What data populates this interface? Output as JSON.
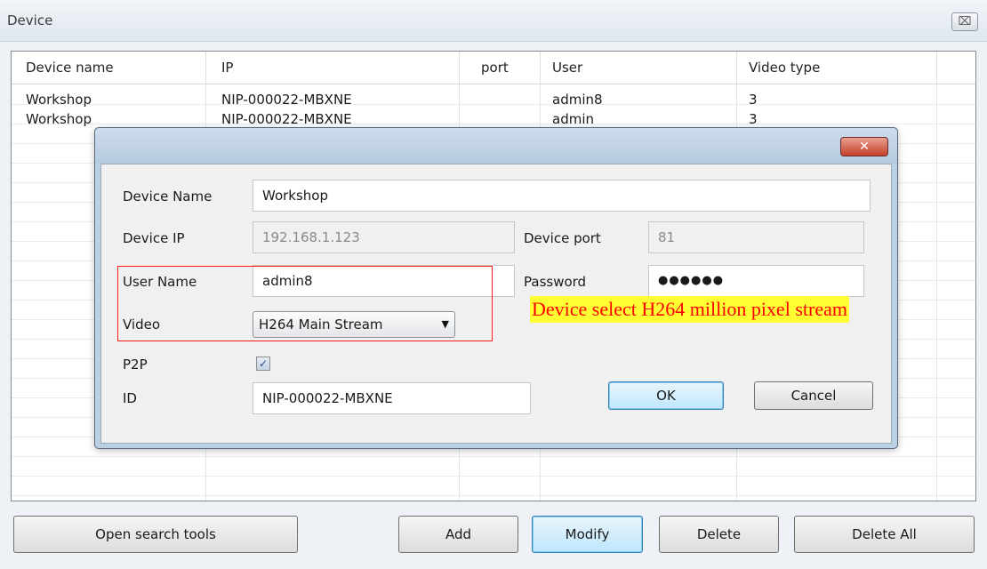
{
  "window": {
    "title": "Device",
    "close_glyph": "⌧"
  },
  "device_list": {
    "columns": [
      "Device name",
      "IP",
      "port",
      "User",
      "Video type"
    ],
    "rows": [
      {
        "name": "Workshop",
        "ip": "NIP-000022-MBXNE",
        "port": "",
        "user": "admin8",
        "video_type": "3"
      },
      {
        "name": "Workshop",
        "ip": "NIP-000022-MBXNE",
        "port": "",
        "user": "admin",
        "video_type": "3"
      }
    ]
  },
  "dialog": {
    "close_glyph": "✕",
    "device_name_label": "Device Name",
    "device_name_value": "Workshop",
    "device_ip_label": "Device IP",
    "device_ip_value": "192.168.1.123",
    "device_port_label": "Device port",
    "device_port_value": "81",
    "user_name_label": "User Name",
    "user_name_value": "admin8",
    "password_label": "Password",
    "password_value": "●●●●●●",
    "video_label": "Video",
    "video_value": "H264 Main Stream",
    "p2p_label": "P2P",
    "p2p_checked": true,
    "p2p_check_glyph": "✓",
    "id_label": "ID",
    "id_value": "NIP-000022-MBXNE",
    "ok_label": "OK",
    "cancel_label": "Cancel"
  },
  "annotation": {
    "text": "Device select H264 million pixel stream",
    "text_color": "#ff0000",
    "highlight_color": "#ffff33"
  },
  "toolbar": {
    "open_search_label": "Open search tools",
    "add_label": "Add",
    "modify_label": "Modify",
    "delete_label": "Delete",
    "delete_all_label": "Delete All"
  }
}
